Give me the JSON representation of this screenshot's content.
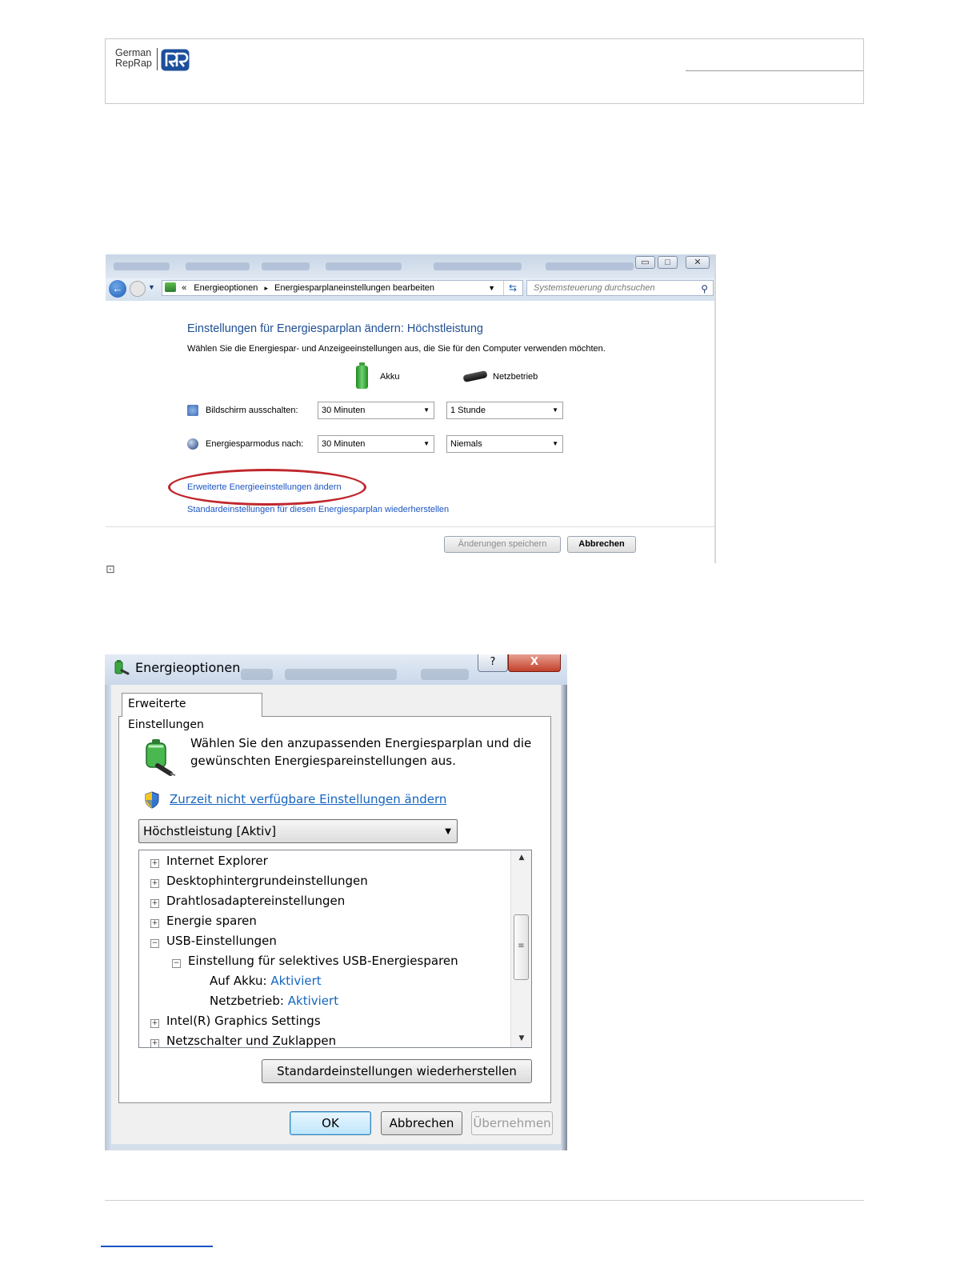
{
  "header": {
    "logo_line1": "German",
    "logo_line2": "RepRap"
  },
  "control_panel": {
    "breadcrumb_prefix": "«",
    "breadcrumb_1": "Energieoptionen",
    "breadcrumb_sep": "▸",
    "breadcrumb_2": "Energiesparplaneinstellungen bearbeiten",
    "search_placeholder": "Systemsteuerung durchsuchen",
    "heading": "Einstellungen für Energiesparplan ändern: Höchstleistung",
    "subtitle": "Wählen Sie die Energiespar- und Anzeigeeinstellungen aus, die Sie für den Computer verwenden möchten.",
    "col_battery": "Akku",
    "col_plugged": "Netzbetrieb",
    "rows": [
      {
        "label": "Bildschirm ausschalten:",
        "battery": "30 Minuten",
        "plugged": "1 Stunde"
      },
      {
        "label": "Energiesparmodus nach:",
        "battery": "30 Minuten",
        "plugged": "Niemals"
      }
    ],
    "link_advanced": "Erweiterte Energieeinstellungen ändern",
    "link_restore": "Standardeinstellungen für diesen Energiesparplan wiederherstellen",
    "btn_save": "Änderungen speichern",
    "btn_cancel": "Abbrechen"
  },
  "dialog": {
    "title": "Energieoptionen",
    "help_glyph": "?",
    "close_glyph": "X",
    "tab": "Erweiterte Einstellungen",
    "intro": "Wählen Sie den anzupassenden Energiesparplan und die gewünschten Energiespareinstellungen aus.",
    "link_unavailable": "Zurzeit nicht verfügbare Einstellungen ändern",
    "plan_selected": "Höchstleistung [Aktiv]",
    "tree": [
      {
        "label": "Internet Explorer",
        "toggle": "+",
        "value": ""
      },
      {
        "label": "Desktophintergrundeinstellungen",
        "toggle": "+",
        "value": ""
      },
      {
        "label": "Drahtlosadaptereinstellungen",
        "toggle": "+",
        "value": ""
      },
      {
        "label": "Energie sparen",
        "toggle": "+",
        "value": ""
      },
      {
        "label": "USB-Einstellungen",
        "toggle": "−",
        "value": ""
      },
      {
        "label": "Einstellung für selektives USB-Energiesparen",
        "toggle": "−",
        "value": ""
      },
      {
        "label": "Auf Akku:",
        "toggle": "",
        "value": "Aktiviert"
      },
      {
        "label": "Netzbetrieb:",
        "toggle": "",
        "value": "Aktiviert"
      },
      {
        "label": "Intel(R) Graphics Settings",
        "toggle": "+",
        "value": ""
      },
      {
        "label": "Netzschalter und Zuklappen",
        "toggle": "+",
        "value": ""
      }
    ],
    "btn_restore": "Standardeinstellungen wiederherstellen",
    "btn_ok": "OK",
    "btn_cancel": "Abbrechen",
    "btn_apply": "Übernehmen"
  },
  "colors": {
    "link_blue": "#1565c0",
    "highlight_red": "#c0272d",
    "heading_blue": "#1e4f94"
  }
}
